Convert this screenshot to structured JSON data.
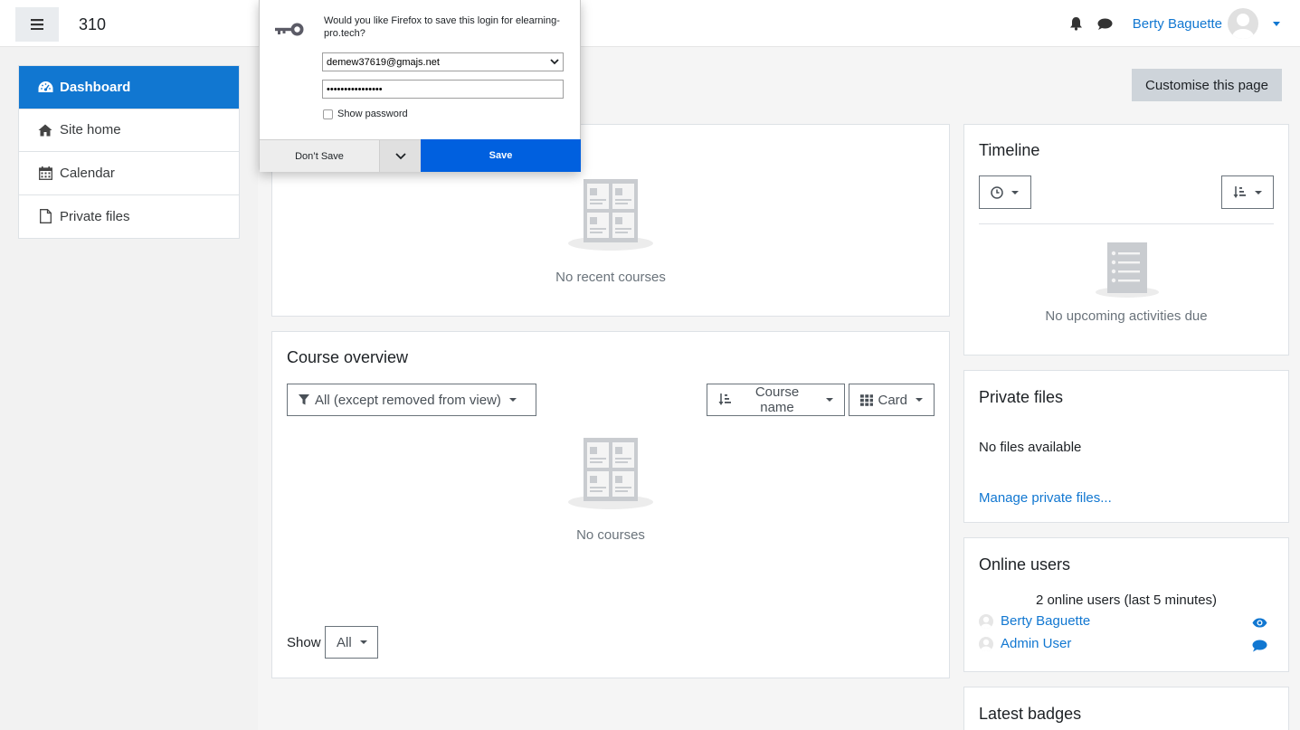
{
  "navbar": {
    "site_name": "310",
    "user_name": "Berty Baguette"
  },
  "nav": {
    "items": [
      {
        "label": "Dashboard",
        "icon": "dashboard-icon",
        "active": true
      },
      {
        "label": "Site home",
        "icon": "home-icon"
      },
      {
        "label": "Calendar",
        "icon": "calendar-icon"
      },
      {
        "label": "Private files",
        "icon": "file-icon"
      }
    ]
  },
  "main": {
    "customise_label": "Customise this page",
    "recent": {
      "empty_text": "No recent courses"
    },
    "course_overview": {
      "title": "Course overview",
      "filter_label": "All (except removed from view)",
      "sort_label": "Course name",
      "view_label": "Card",
      "empty_text": "No courses",
      "show_label": "Show",
      "show_value": "All"
    }
  },
  "side": {
    "timeline": {
      "title": "Timeline",
      "empty_text": "No upcoming activities due"
    },
    "private_files": {
      "title": "Private files",
      "empty_text": "No files available",
      "manage_link": "Manage private files..."
    },
    "online_users": {
      "title": "Online users",
      "summary": "2 online users (last 5 minutes)",
      "users": [
        {
          "name": "Berty Baguette"
        },
        {
          "name": "Admin User"
        }
      ]
    },
    "latest_badges": {
      "title": "Latest badges"
    }
  },
  "popup": {
    "question": "Would you like Firefox to save this login for elearning-pro.tech?",
    "username": "demew37619@gmajs.net",
    "password": "••••••••••••••••",
    "show_password": "Show password",
    "dont_save": "Don’t Save",
    "save": "Save"
  },
  "colors": {
    "accent": "#1177d1",
    "firefox_blue": "#0060df"
  }
}
